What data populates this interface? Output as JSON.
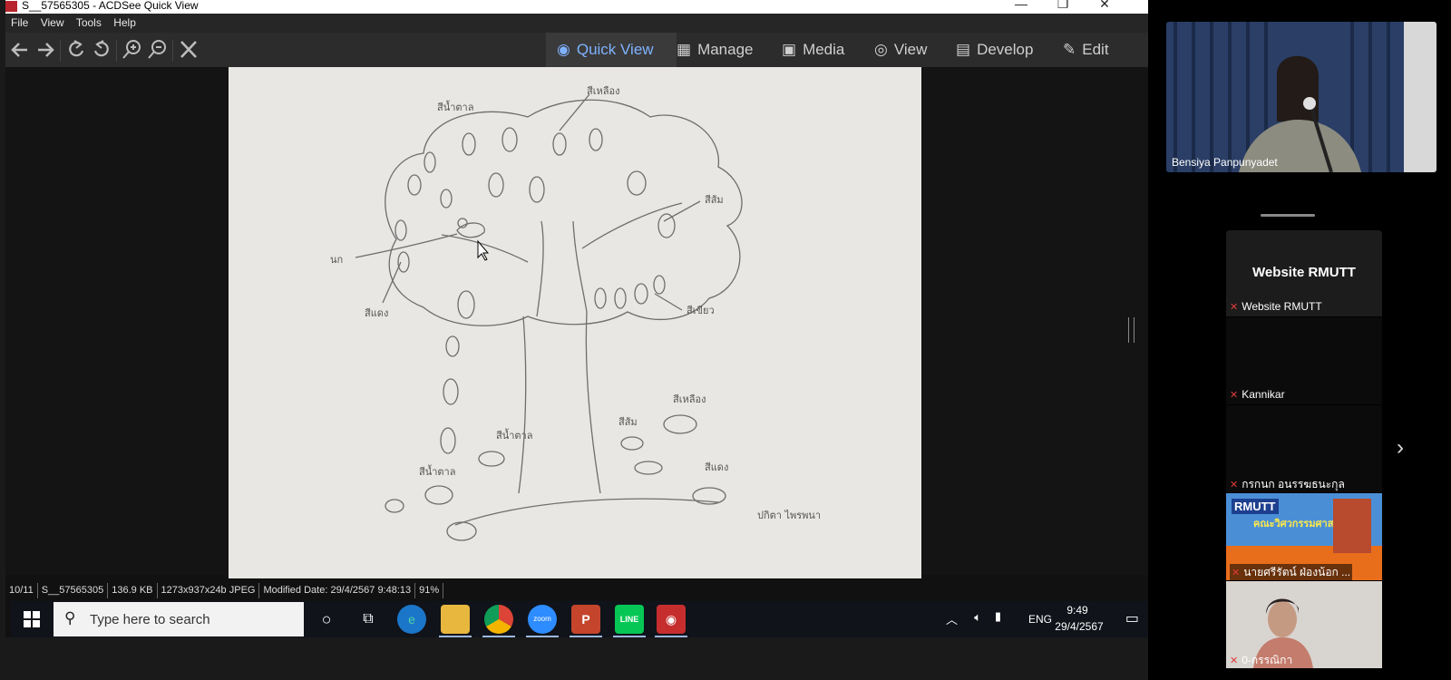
{
  "window": {
    "title": "S__57565305 - ACDSee Quick View",
    "controls": [
      "—",
      "❐",
      "✕"
    ]
  },
  "menu": [
    "File",
    "View",
    "Tools",
    "Help"
  ],
  "toolbar": {
    "modes": [
      {
        "label": "Quick View",
        "icon": "eye-icon",
        "active": true
      },
      {
        "label": "Manage",
        "icon": "grid-icon"
      },
      {
        "label": "Media",
        "icon": "media-icon"
      },
      {
        "label": "View",
        "icon": "view-eye-icon"
      },
      {
        "label": "Develop",
        "icon": "develop-icon"
      },
      {
        "label": "Edit",
        "icon": "edit-icon"
      }
    ]
  },
  "drawing": {
    "labels": [
      "สีเหลือง",
      "สีน้ำตาล",
      "สีส้ม",
      "นก",
      "สีแดง",
      "สีเขียว",
      "สีเหลือง",
      "สีน้ำตาล",
      "สีส้ม",
      "สีน้ำตาล",
      "สีแดง",
      "ปกิตา ไพรพนา"
    ]
  },
  "status": {
    "index": "10/11",
    "filename": "S__57565305",
    "size": "136.9 KB",
    "dims": "1273x937x24b JPEG",
    "modified": "Modified Date: 29/4/2567 9:48:13",
    "zoom": "91%"
  },
  "taskbar": {
    "search_placeholder": "Type here to search",
    "tray_lang": "ENG",
    "time": "9:49",
    "date": "29/4/2567"
  },
  "zoom": {
    "speaker_name": "Bensiya Panpunyadet",
    "tiles": [
      {
        "heading": "Website RMUTT",
        "label": "Website RMUTT"
      },
      {
        "label": "Kannikar"
      },
      {
        "label": "กรกนก อนรรฆธนะกุล"
      },
      {
        "label": "นายศรีรัตน์ ฝ่องน้อก ...",
        "logo_text": "RMUTT",
        "banner_text": "คณะวิศวกรรมศาสตร์"
      },
      {
        "label": "0-กรรณิกา"
      }
    ]
  }
}
